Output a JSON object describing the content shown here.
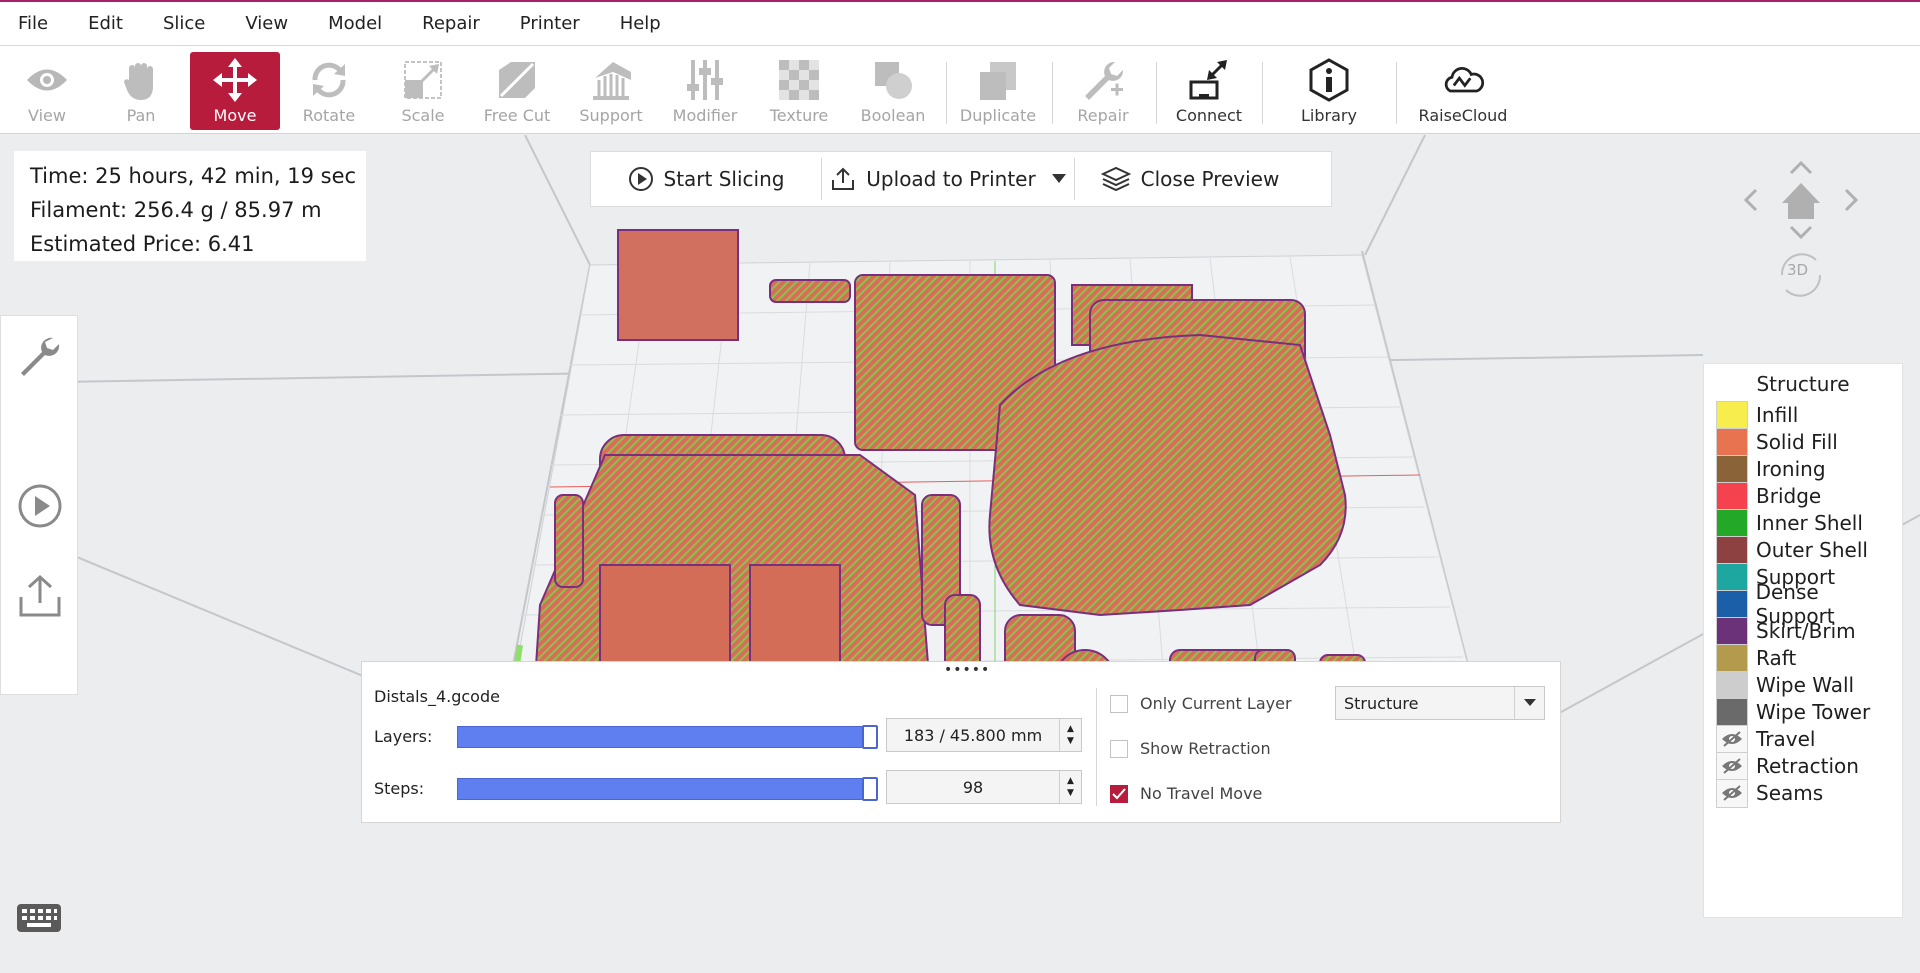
{
  "menu": [
    "File",
    "Edit",
    "Slice",
    "View",
    "Model",
    "Repair",
    "Printer",
    "Help"
  ],
  "toolbar": {
    "view": "View",
    "pan": "Pan",
    "move": "Move",
    "rotate": "Rotate",
    "scale": "Scale",
    "free_cut": "Free Cut",
    "support": "Support",
    "modifier": "Modifier",
    "texture": "Texture",
    "boolean": "Boolean",
    "duplicate": "Duplicate",
    "repair": "Repair",
    "connect": "Connect",
    "library": "Library",
    "raisecloud": "RaiseCloud"
  },
  "stats": {
    "time": "Time: 25 hours, 42 min, 19 sec",
    "filament": "Filament: 256.4 g / 85.97 m",
    "price": "Estimated Price: 6.41"
  },
  "actions": {
    "start_slicing": "Start Slicing",
    "upload": "Upload to Printer",
    "close_preview": "Close Preview"
  },
  "navcube": {
    "label": "3D"
  },
  "legend": {
    "title": "Structure",
    "items": [
      {
        "label": "Infill",
        "color": "#f7ee4e"
      },
      {
        "label": "Solid Fill",
        "color": "#e77350"
      },
      {
        "label": "Ironing",
        "color": "#8b6339"
      },
      {
        "label": "Bridge",
        "color": "#f4434f"
      },
      {
        "label": "Inner Shell",
        "color": "#23a827"
      },
      {
        "label": "Outer Shell",
        "color": "#8d4141"
      },
      {
        "label": "Support",
        "color": "#1ea6a1"
      },
      {
        "label": "Dense Support",
        "color": "#1a5fa8"
      },
      {
        "label": "Skirt/Brim",
        "color": "#6b327a"
      },
      {
        "label": "Raft",
        "color": "#b39a4c"
      },
      {
        "label": "Wipe Wall",
        "color": "#cdcdcd"
      },
      {
        "label": "Wipe Tower",
        "color": "#6a6a6a"
      }
    ],
    "hidden_items": [
      {
        "label": "Travel"
      },
      {
        "label": "Retraction"
      },
      {
        "label": "Seams"
      }
    ]
  },
  "preview": {
    "filename": "Distals_4.gcode",
    "layers_label": "Layers:",
    "layers_value": "183 / 45.800 mm",
    "steps_label": "Steps:",
    "steps_value": "98",
    "only_current_layer": "Only Current Layer",
    "show_retraction": "Show Retraction",
    "no_travel_move": "No Travel Move",
    "mode": "Structure"
  }
}
